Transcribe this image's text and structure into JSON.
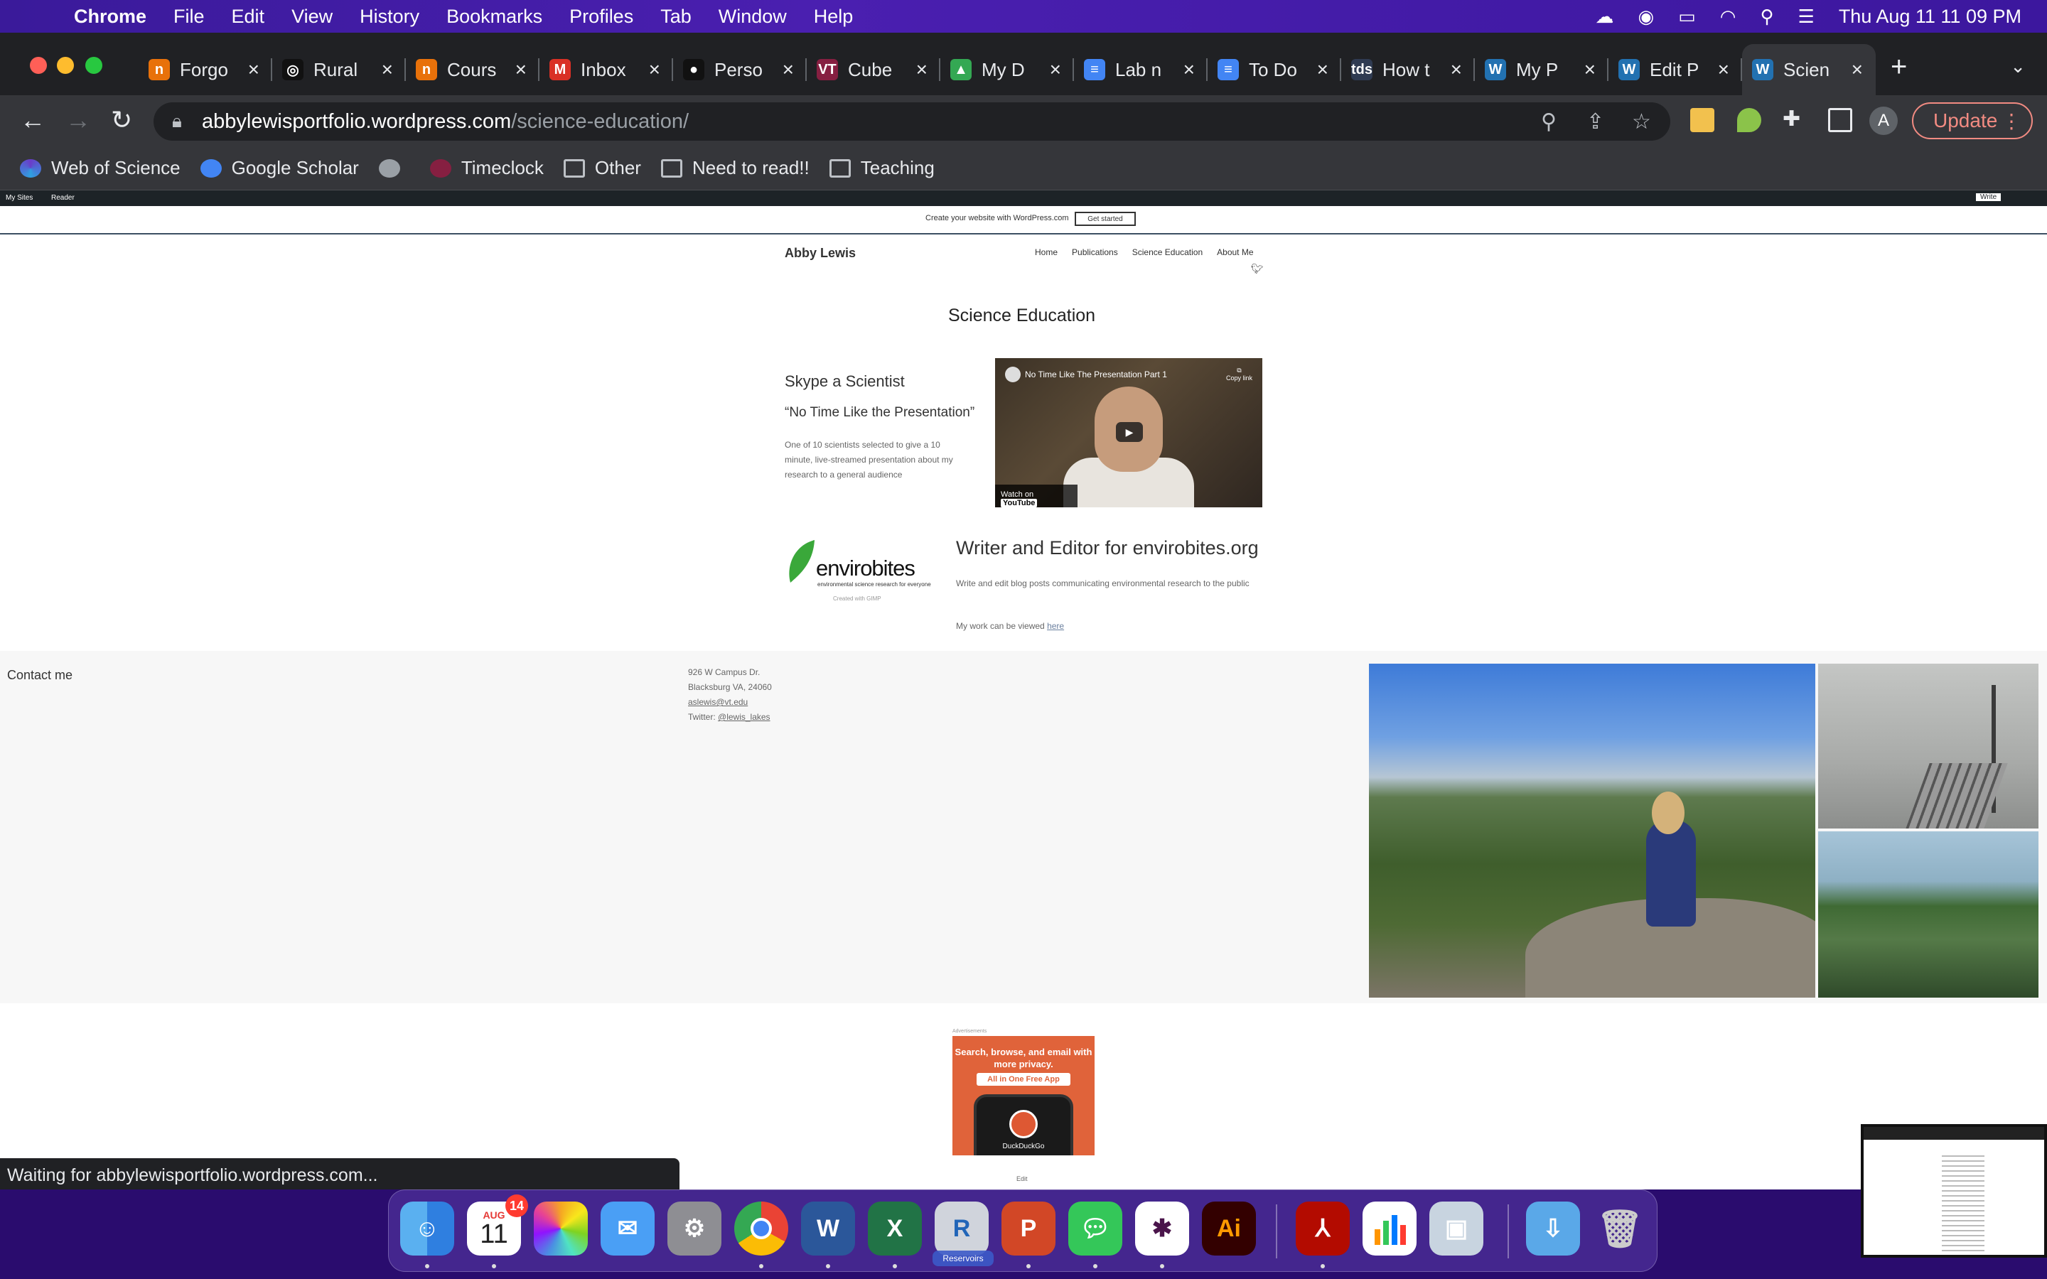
{
  "menubar": {
    "app": "Chrome",
    "items": [
      "File",
      "Edit",
      "View",
      "History",
      "Bookmarks",
      "Profiles",
      "Tab",
      "Window",
      "Help"
    ],
    "datetime": "Thu Aug 11  11 09 PM"
  },
  "tabs": [
    {
      "title": "Forgo",
      "icon": "n-icon",
      "color": "#e8710a",
      "glyph": "n"
    },
    {
      "title": "Rural",
      "icon": "ring-icon",
      "color": "#111111",
      "glyph": "◎"
    },
    {
      "title": "Cours",
      "icon": "n-icon",
      "color": "#e8710a",
      "glyph": "n"
    },
    {
      "title": "Inbox",
      "icon": "gmail-icon",
      "color": "#d93025",
      "glyph": "M"
    },
    {
      "title": "Perso",
      "icon": "github-icon",
      "color": "#111111",
      "glyph": "●"
    },
    {
      "title": "Cube",
      "icon": "vt-icon",
      "color": "#861f41",
      "glyph": "VT"
    },
    {
      "title": "My D",
      "icon": "drive-icon",
      "color": "#34a853",
      "glyph": "▲"
    },
    {
      "title": "Lab n",
      "icon": "docs-icon",
      "color": "#4285f4",
      "glyph": "≡"
    },
    {
      "title": "To Do",
      "icon": "docs-icon",
      "color": "#4285f4",
      "glyph": "≡"
    },
    {
      "title": "How t",
      "icon": "tds-icon",
      "color": "#2f3b52",
      "glyph": "tds"
    },
    {
      "title": "My P",
      "icon": "wordpress-icon",
      "color": "#2271b1",
      "glyph": "W"
    },
    {
      "title": "Edit P",
      "icon": "wordpress-icon",
      "color": "#2271b1",
      "glyph": "W"
    },
    {
      "title": "Scien",
      "icon": "wordpress-icon",
      "color": "#2271b1",
      "glyph": "W",
      "active": true
    }
  ],
  "address": {
    "domain": "abbylewisportfolio.wordpress.com",
    "path": "/science-education/"
  },
  "toolbar": {
    "update_label": "Update",
    "avatar_letter": "A"
  },
  "bookmarks": [
    {
      "label": "Web of Science",
      "icon": "clarivate-icon"
    },
    {
      "label": "Google Scholar",
      "icon": "scholar-icon"
    },
    {
      "label": "",
      "icon": "globe-icon"
    },
    {
      "label": "Timeclock",
      "icon": "vt-icon"
    },
    {
      "label": "Other",
      "icon": "folder-icon"
    },
    {
      "label": "Need to read!!",
      "icon": "folder-icon"
    },
    {
      "label": "Teaching",
      "icon": "folder-icon"
    }
  ],
  "wpbar": {
    "my_sites": "My Sites",
    "reader": "Reader",
    "write": "Write"
  },
  "promo": {
    "text": "Create your website with WordPress.com",
    "button": "Get started"
  },
  "site": {
    "title": "Abby Lewis",
    "nav": [
      "Home",
      "Publications",
      "Science Education",
      "About Me"
    ]
  },
  "page": {
    "title": "Science Education",
    "skype_heading": "Skype a Scientist",
    "skype_quote": "“No Time Like the Presentation”",
    "skype_text": "One of 10 scientists selected to give a 10 minute, live-streamed presentation about my research to a general audience",
    "video_title": "No Time Like The Presentation Part 1",
    "video_copy": "Copy link",
    "video_watch": "Watch on",
    "video_brand": "YouTube",
    "enviro_brand": "envirobites",
    "enviro_tag": "environmental science research for everyone",
    "enviro_gimp": "Created with GIMP",
    "writer_heading": "Writer and Editor for envirobites.org",
    "writer_text": "Write and edit blog posts communicating environmental research to the public",
    "work_text": "My work can be viewed ",
    "work_link": "here"
  },
  "footer": {
    "contact_heading": "Contact me",
    "address_line1": "926 W Campus Dr.",
    "address_line2": "Blacksburg VA, 24060",
    "email": "aslewis@vt.edu",
    "twitter_label": "Twitter: ",
    "twitter_handle": "@lewis_lakes"
  },
  "ad": {
    "label": "Advertisements",
    "line1": "Search, browse, and email with more privacy.",
    "pill": "All in One Free App",
    "brand": "DuckDuckGo",
    "edit": "Edit"
  },
  "status": "Waiting for abbylewisportfolio.wordpress.com...",
  "dock": {
    "calendar_month": "AUG",
    "calendar_day": "11",
    "calendar_badge": "14",
    "r_label": "Reservoirs"
  }
}
